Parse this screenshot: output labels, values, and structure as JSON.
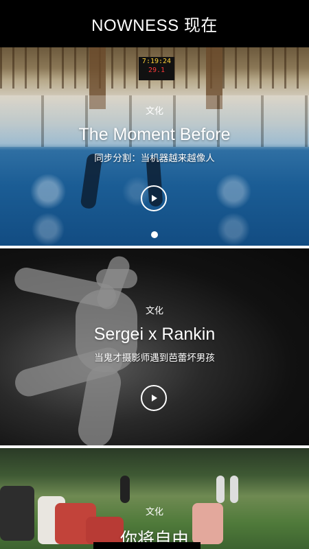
{
  "header": {
    "title": "NOWNESS 现在"
  },
  "cards": [
    {
      "category": "文化",
      "title": "The Moment Before",
      "subtitle": "同步分割：当机器越来越像人",
      "scoreboard": {
        "time": "7:19:24",
        "score": "29.1"
      }
    },
    {
      "category": "文化",
      "title": "Sergei x Rankin",
      "subtitle": "当鬼才摄影师遇到芭蕾坏男孩"
    },
    {
      "category": "文化",
      "title": "你将自由",
      "subtitle": ""
    }
  ],
  "carousel": {
    "active_index": 1,
    "dot_count": 1
  },
  "icons": {
    "play": "play-icon"
  },
  "colors": {
    "background": "#000000",
    "text": "#ffffff"
  }
}
